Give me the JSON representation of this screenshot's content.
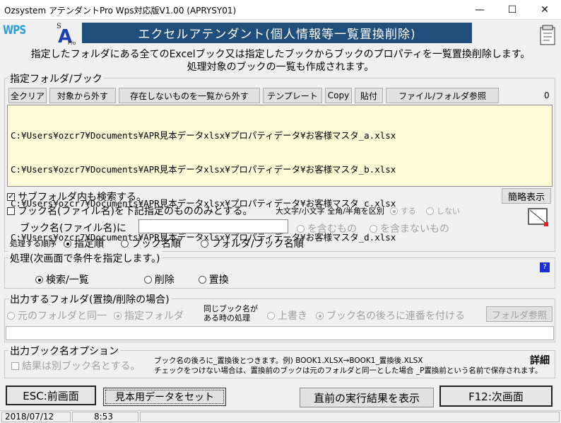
{
  "window": {
    "title": "Ozsystem アテンダントPro Wps対応版V1.00 (APRYSY01)",
    "minimize": "—",
    "maximize": "☐",
    "close": "✕"
  },
  "header": {
    "wps_logo": "WPS",
    "header_title": "エクセルアテンダント(個人情報等一覧置換削除)",
    "desc_line1": "指定したフォルダにある全てのExcelブック又は指定したブックからブックのプロパティを一覧置換削除します。",
    "desc_line2": "処理対象のブックの一覧も作成されます。"
  },
  "folder_group": {
    "label": "指定フォルダ/ブック",
    "buttons": [
      "全クリア",
      "対象から外す",
      "存在しないものを一覧から外す",
      "テンプレート",
      "Copy",
      "貼付",
      "ファイル/フォルダ参照"
    ],
    "count": "0",
    "files": [
      "C:¥Users¥ozcr7¥Documents¥APR見本データxlsx¥プロパティデータ¥お客様マスタ_a.xlsx",
      "C:¥Users¥ozcr7¥Documents¥APR見本データxlsx¥プロパティデータ¥お客様マスタ_b.xlsx",
      "C:¥Users¥ozcr7¥Documents¥APR見本データxlsx¥プロパティデータ¥お客様マスタ_c.xlsx",
      "C:¥Users¥ozcr7¥Documents¥APR見本データxlsx¥プロパティデータ¥お客様マスタ_d.xlsx"
    ],
    "subfolder_label": "サブフォルダ内も検索する。",
    "summary_button": "簡略表示",
    "bookname_only_label": "ブック名(ファイル名)を下記指定のもののみとする。",
    "case_label": "大文字/小文字 全角/半角を区別",
    "opt_yes": "する",
    "opt_no": "しない",
    "bookname_field_label": "ブック名(ファイル名)に",
    "bookname_value": "",
    "contains_label": "を含むもの",
    "not_contains_label": "を含まないもの",
    "order_label": "処理する順序",
    "order_opts": [
      "指定順",
      "ブック名順",
      "フォルダ/ブック名順"
    ]
  },
  "process_group": {
    "label": "処理(次画面で条件を指定します。)",
    "opts": [
      "検索/一覧",
      "削除",
      "置換"
    ],
    "help": "?"
  },
  "output_group": {
    "label": "出力するフォルダ(置換/削除の場合)",
    "same_folder": "元のフォルダと同一",
    "specified_folder": "指定フォルダ",
    "same_name_line1": "同じブック名が",
    "same_name_line2": "ある時の処理",
    "overwrite": "上書き",
    "append_seq": "ブック名の後ろに連番を付ける",
    "browse": "フォルダ参照",
    "folder_value": ""
  },
  "bookname_group": {
    "label": "出力ブック名オプション",
    "separate_label": "結果は別ブック名とする。",
    "note1": "ブック名の後ろに_置換後とつきます。例) BOOK1.XLSX→BOOK1_置換後.XLSX",
    "note2": "チェックをつけない場合は、置換前のブックは元のフォルダと同一とした場合 _P置換前という名前で保存されます。",
    "detail": "詳細"
  },
  "bottom": {
    "esc": "ESC:前画面",
    "sample": "見本用データをセット",
    "prev_result": "直前の実行結果を表示",
    "f12": "F12:次画面"
  },
  "status": {
    "date": "2018/07/12",
    "time": "8:53"
  },
  "colors": {
    "header_bg": "#1f4f7a",
    "list_bg": "#fffbd6",
    "help_bg": "#1a2fd8"
  }
}
